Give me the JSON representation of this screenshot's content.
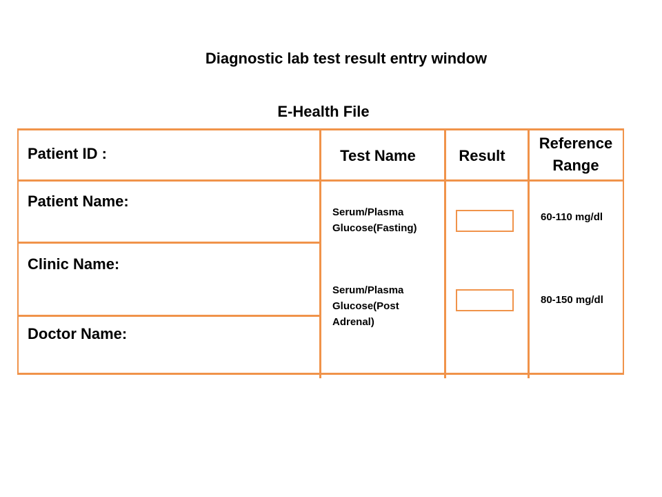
{
  "page": {
    "title": "Diagnostic lab test result entry window",
    "subtitle": "E-Health File"
  },
  "patient_info": {
    "patient_id_label": "Patient ID :",
    "patient_name_label": "Patient Name:",
    "clinic_name_label": "Clinic Name:",
    "doctor_name_label": "Doctor Name:"
  },
  "table": {
    "headers": {
      "test_name": "Test Name",
      "result": "Result",
      "reference_range": "Reference Range"
    },
    "rows": [
      {
        "test_name": "Serum/Plasma Glucose(Fasting)",
        "result_value": "",
        "reference_range": "60-110 mg/dl"
      },
      {
        "test_name": "Serum/Plasma Glucose(Post Adrenal)",
        "result_value": "",
        "reference_range": "80-150 mg/dl"
      }
    ]
  },
  "colors": {
    "border": "#F0934A",
    "background": "#FFFFFF",
    "text": "#000000"
  }
}
